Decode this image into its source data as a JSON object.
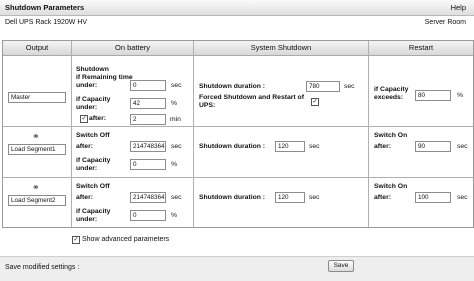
{
  "header": {
    "title": "Shutdown Parameters",
    "help": "Help"
  },
  "device": {
    "model": "Dell UPS Rack 1920W HV",
    "location": "Server Room"
  },
  "columns": {
    "output": "Output",
    "on_battery": "On battery",
    "system_shutdown": "System Shutdown",
    "restart": "Restart"
  },
  "rows": [
    {
      "output_name": "Master",
      "on_battery": {
        "shutdown_label": "Shutdown",
        "remaining_label": "if Remaining time under:",
        "remaining_value": "0",
        "remaining_unit": "sec",
        "capacity_label": "if Capacity under:",
        "capacity_value": "42",
        "capacity_unit": "%",
        "after_label": "after:",
        "after_value": "2",
        "after_unit": "min",
        "after_checked": true
      },
      "system_shutdown": {
        "duration_label": "Shutdown duration :",
        "duration_value": "780",
        "duration_unit": "sec",
        "forced_label": "Forced Shutdown and Restart of UPS:",
        "forced_checked": true
      },
      "restart": {
        "label": "if Capacity exceeds:",
        "value": "80",
        "unit": "%"
      }
    },
    {
      "output_name": "Load Segment1",
      "on_battery": {
        "switch_off_label": "Switch Off",
        "after_label": "after:",
        "after_value": "2147483647",
        "after_unit": "sec",
        "capacity_label": "if Capacity under:",
        "capacity_value": "0",
        "capacity_unit": "%"
      },
      "system_shutdown": {
        "duration_label": "Shutdown duration :",
        "duration_value": "120",
        "duration_unit": "sec"
      },
      "restart": {
        "switch_on_label": "Switch On",
        "after_label": "after:",
        "after_value": "90",
        "after_unit": "sec"
      }
    },
    {
      "output_name": "Load Segment2",
      "on_battery": {
        "switch_off_label": "Switch Off",
        "after_label": "after:",
        "after_value": "2147483647",
        "after_unit": "sec",
        "capacity_label": "if Capacity under:",
        "capacity_value": "0",
        "capacity_unit": "%"
      },
      "system_shutdown": {
        "duration_label": "Shutdown duration :",
        "duration_value": "120",
        "duration_unit": "sec"
      },
      "restart": {
        "switch_on_label": "Switch On",
        "after_label": "after:",
        "after_value": "100",
        "after_unit": "sec"
      }
    }
  ],
  "advanced": {
    "label": "Show advanced parameters",
    "checked": true
  },
  "footer": {
    "label": "Save modified settings :",
    "save": "Save"
  },
  "icons": {
    "load_segment": "plug-icon",
    "checkbox": "checkmark-icon"
  }
}
